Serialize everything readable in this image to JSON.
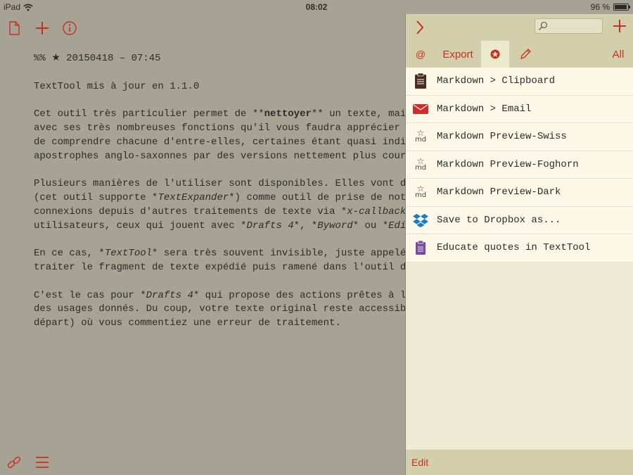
{
  "status_bar": {
    "device": "iPad",
    "time": "08:02",
    "battery_text": "96 %",
    "battery_level": 0.96
  },
  "editor": {
    "toolbar": {
      "new_doc_icon": "document-icon",
      "add_icon": "plus-icon",
      "info_icon": "info-icon"
    },
    "lines": {
      "l1": "%% ★ 20150418 – 07:45",
      "l2": "TextTool mis à jour en 1.1.0",
      "l3a": "Cet outil très particulier permet de **",
      "l3b": "nettoyer",
      "l3c": "** un texte, mais éga",
      "l4": "avec ses très nombreuses fonctions qu'il vous faudra apprécier indiv",
      "l5": "de comprendre chacune d'entre-elles, certaines étant quasi indispens",
      "l6": "apostrophes anglo-saxonnes par des versions nettement plus courbes.",
      "l7": "Plusieurs manières de l'utiliser sont disponibles. Elles vont de l'",
      "l8a": "(cet outil supporte *",
      "l8b": "TextExpander",
      "l8c": "*) comme outil de prise de notes e",
      "l9a": "connexions depuis d'autres traitements de texte via *",
      "l9b": "x-callback-url",
      "l10a": "utilisateurs, ceux qui jouent avec *",
      "l10b": "Drafts 4",
      "l10c": "*, *",
      "l10d": "Byword",
      "l10e": "* ou *",
      "l10f": "Editori",
      "l11a": "En ce cas, *",
      "l11b": "TextTool",
      "l11c": "* sera très souvent invisible, juste appelé par",
      "l12": "traiter le fragment de texte expédié puis ramené dans l'outil de dé",
      "l13a": "C'est le cas pour *",
      "l13b": "Drafts 4",
      "l13c": "* qui propose des actions prêtes à l'empl",
      "l14": "des usages donnés. Du coup, votre texte original reste accessible d",
      "l15": "départ) où vous commentiez une erreur de traitement."
    },
    "bottom": {
      "link_icon": "link-icon",
      "menu_icon": "menu-icon"
    }
  },
  "panel": {
    "collapse_icon": "chevron-right-icon",
    "search_icon": "search-icon",
    "add_icon": "plus-icon",
    "tabs": {
      "at": "@",
      "export": "Export",
      "favorites_icon": "star-badge-icon",
      "pencil_icon": "pencil-icon",
      "all": "All"
    },
    "actions": [
      {
        "label": "Markdown > Clipboard",
        "icon": "clipboard-icon"
      },
      {
        "label": "Markdown > Email",
        "icon": "envelope-icon"
      },
      {
        "label": "Markdown Preview-Swiss",
        "icon": "md-star-icon"
      },
      {
        "label": "Markdown Preview-Foghorn",
        "icon": "md-star-icon"
      },
      {
        "label": "Markdown Preview-Dark",
        "icon": "md-star-icon"
      },
      {
        "label": "Save to Dropbox as...",
        "icon": "dropbox-icon"
      },
      {
        "label": "Educate quotes in TextTool",
        "icon": "purple-clipboard-icon"
      }
    ],
    "edit_label": "Edit",
    "md_icon_text": "md",
    "md_icon_star": "☆"
  },
  "colors": {
    "accent": "#c4321d",
    "editor_bg": "#a6a395",
    "panel_bg": "#edebd3",
    "panel_bar": "#d3cfad",
    "row_bg": "#fbf8e7"
  }
}
